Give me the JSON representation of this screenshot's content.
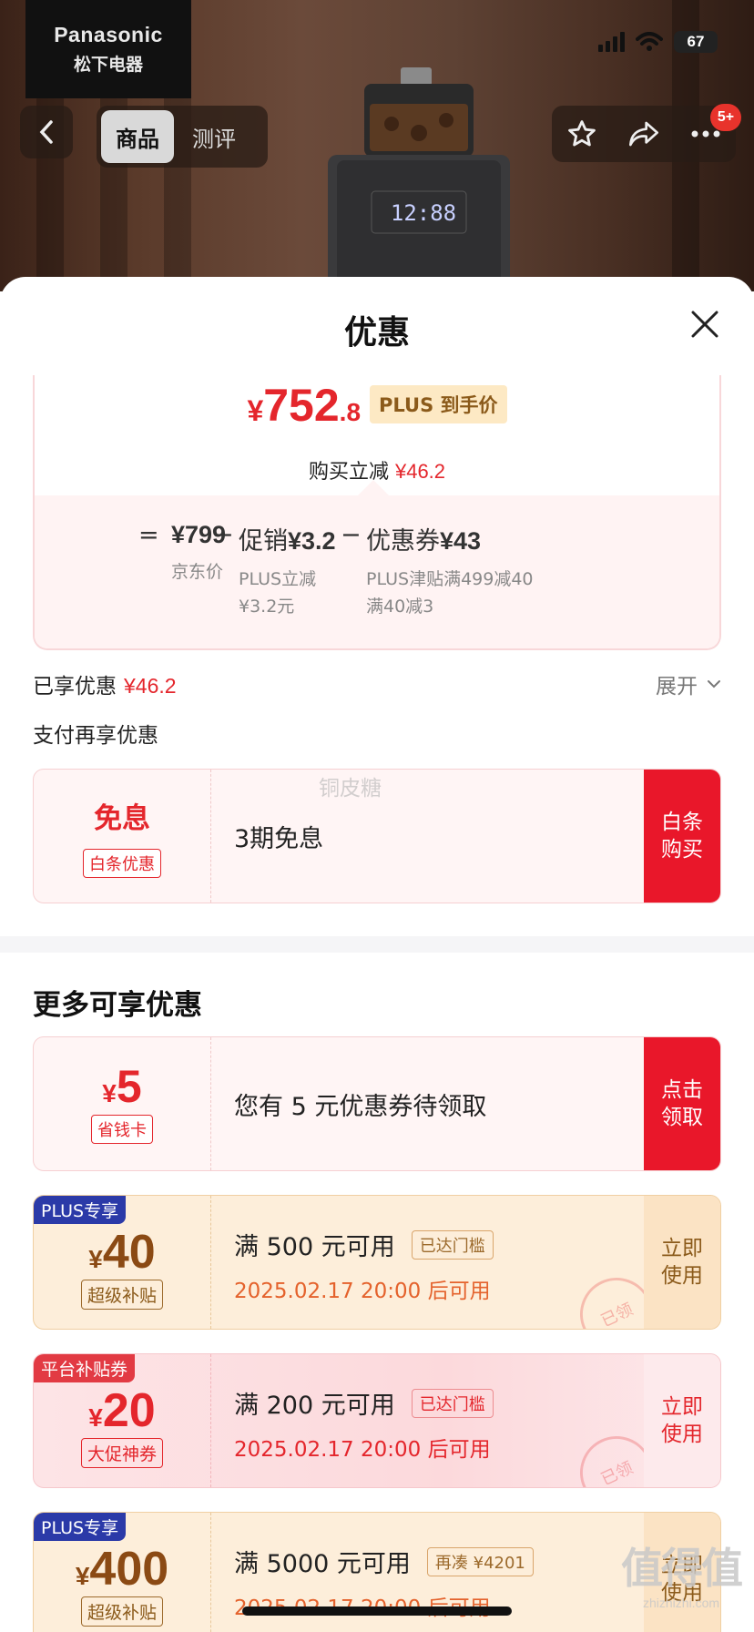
{
  "header": {
    "brand_en": "Panasonic",
    "brand_cn": "松下电器",
    "battery": "67",
    "tabs": [
      {
        "label": "商品"
      },
      {
        "label": "测评"
      }
    ],
    "badge": "5+",
    "machine_display": "12:88"
  },
  "sheet": {
    "title": "优惠",
    "price": {
      "yen": "¥",
      "int": "752",
      "dec": ".8",
      "tag": "PLUS 到手价"
    },
    "instant_reduce": {
      "label": "购买立减",
      "value": "¥46.2"
    },
    "calc": {
      "eq": "=",
      "jd": {
        "value": "¥799",
        "label": "京东价"
      },
      "op1": "−",
      "promo": {
        "label": "促销",
        "value": "¥3.2",
        "sub1": "PLUS立减",
        "sub2": "¥3.2元"
      },
      "op2": "−",
      "coupon": {
        "label": "优惠券",
        "value": "¥43",
        "sub1": "PLUS津贴满499减40",
        "sub2": "满40减3"
      }
    },
    "enjoyed": {
      "label": "已享优惠",
      "value": "¥46.2",
      "expand": "展开"
    },
    "pay_more": "支付再享优惠",
    "watermark": "铜皮糖",
    "baitiao": {
      "title": "免息",
      "tag": "白条优惠",
      "text": "3期免息",
      "action_line1": "白条",
      "action_line2": "购买"
    },
    "more_title": "更多可享优惠",
    "savings": {
      "yen": "¥",
      "amount": "5",
      "tag": "省钱卡",
      "text": "您有 5 元优惠券待领取",
      "action_line1": "点击",
      "action_line2": "领取"
    },
    "coupons": [
      {
        "corner": "PLUS专享",
        "yen": "¥",
        "amount": "40",
        "tag": "超级补贴",
        "cond": "满 500 元可用",
        "chip": "已达门槛",
        "date": "2025.02.17 20:00 后可用",
        "action_line1": "立即",
        "action_line2": "使用",
        "stamp": "已领"
      },
      {
        "corner": "平台补贴券",
        "yen": "¥",
        "amount": "20",
        "tag": "大促神券",
        "cond": "满 200 元可用",
        "chip": "已达门槛",
        "date": "2025.02.17 20:00 后可用",
        "action_line1": "立即",
        "action_line2": "使用",
        "stamp": "已领"
      },
      {
        "corner": "PLUS专享",
        "yen": "¥",
        "amount": "400",
        "tag": "超级补贴",
        "cond": "满 5000 元可用",
        "chip": "再凑 ¥4201",
        "date": "2025.02.17 20:00 后可用",
        "action_line1": "立即",
        "action_line2": "使用"
      }
    ]
  },
  "site_watermark": {
    "big": "值得值",
    "small": "zhizhizhi.com"
  },
  "colors": {
    "accent_red": "#e4262c",
    "gold": "#8b5a1a",
    "plus_blue": "#2b3aa8"
  }
}
